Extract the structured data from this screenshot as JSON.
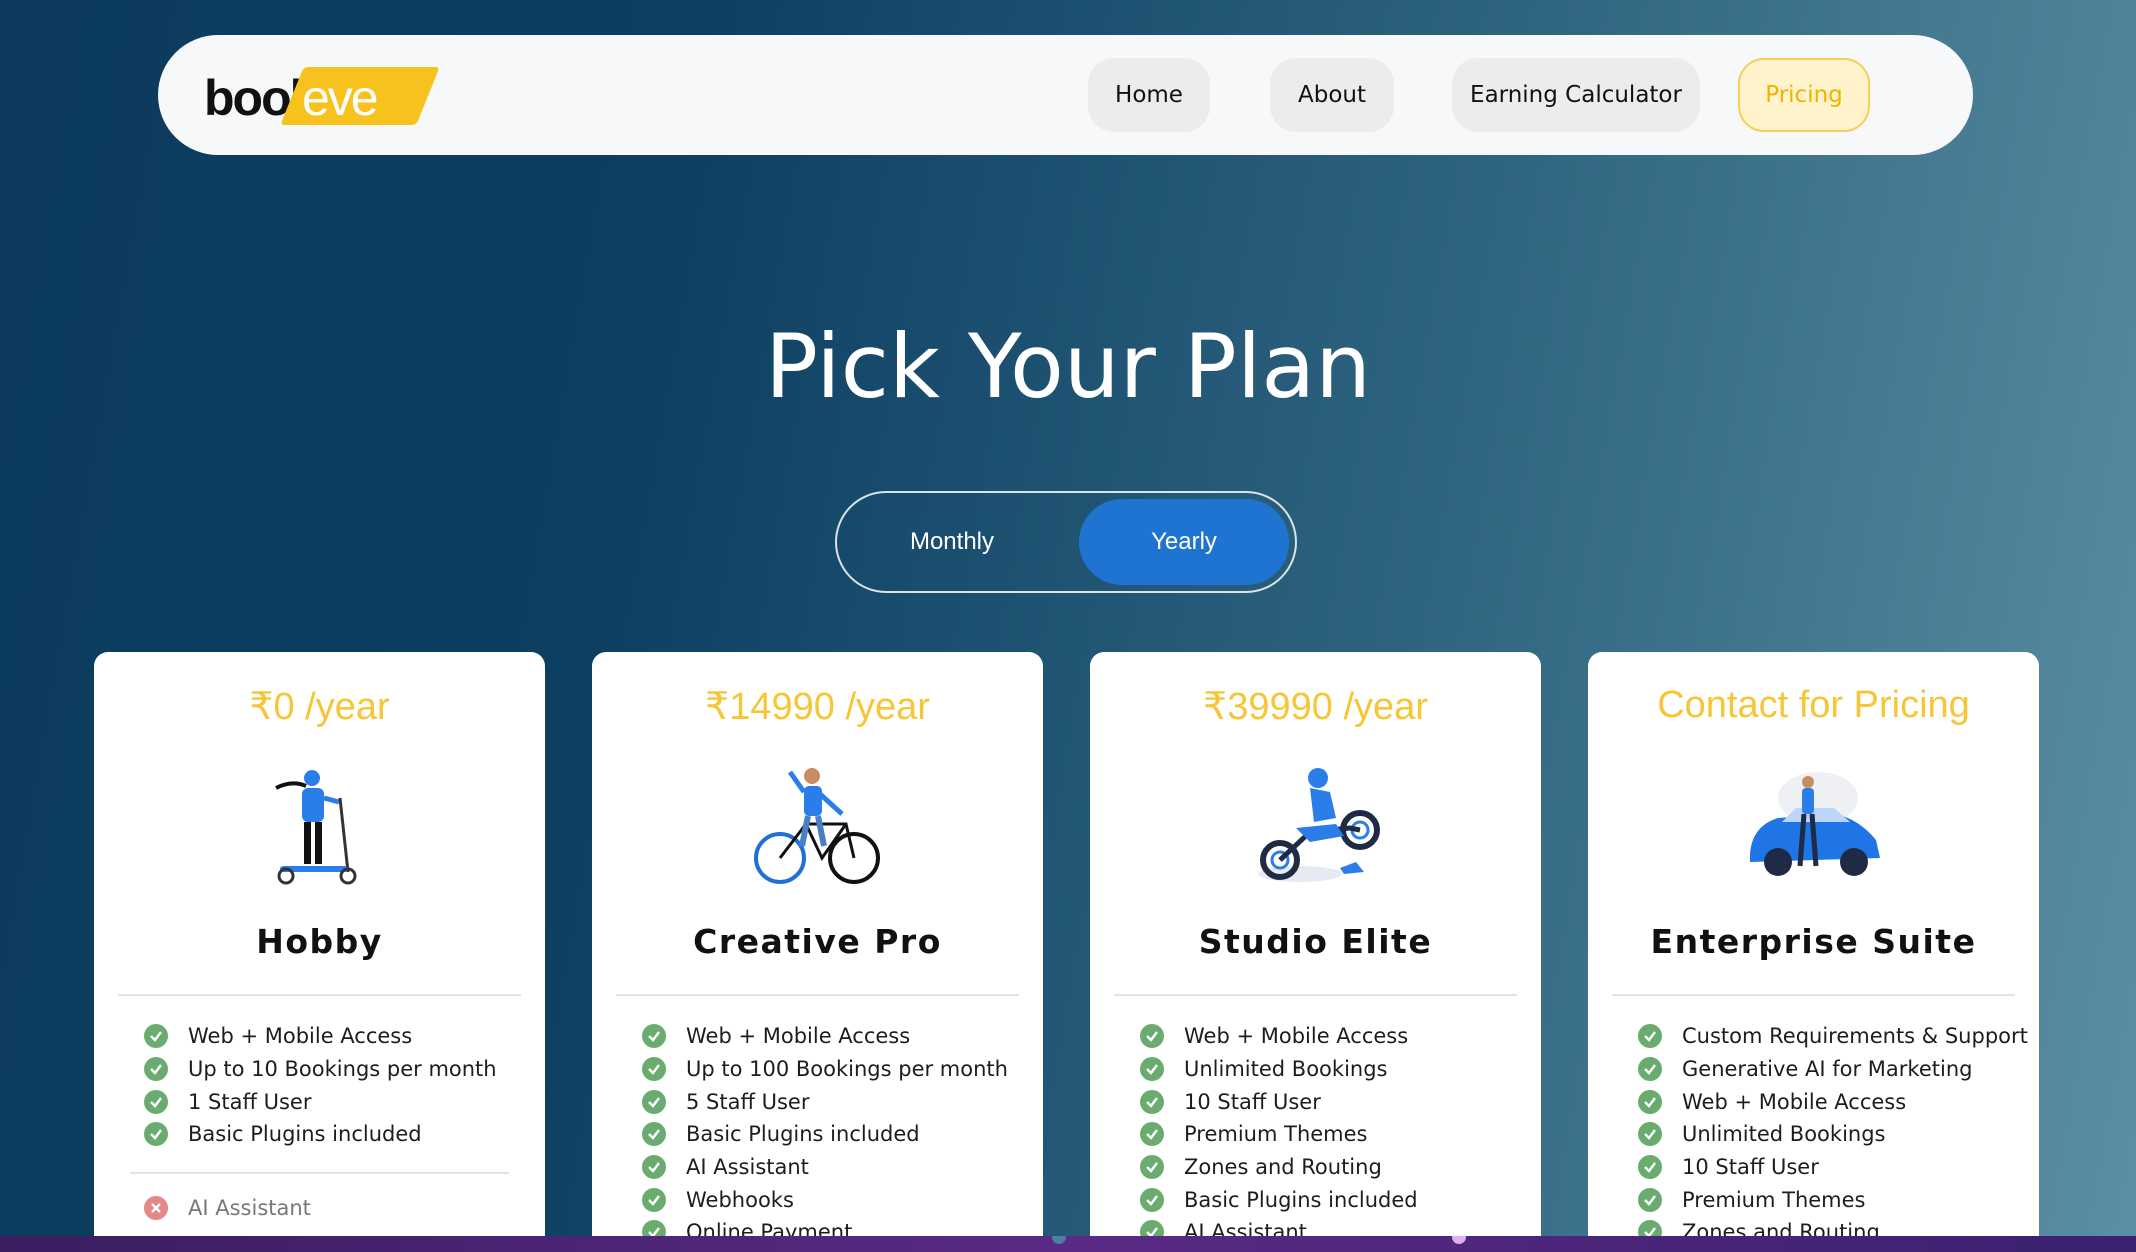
{
  "brand": {
    "logo_part1": "book",
    "logo_part2": "eve"
  },
  "nav": {
    "items": [
      {
        "label": "Home"
      },
      {
        "label": "About"
      },
      {
        "label": "Earning Calculator"
      },
      {
        "label": "Pricing",
        "active": true
      }
    ]
  },
  "hero": {
    "title": "Pick Your Plan"
  },
  "billing_toggle": {
    "monthly_label": "Monthly",
    "yearly_label": "Yearly",
    "selected": "Yearly"
  },
  "plans": [
    {
      "price": "₹0 /year",
      "name": "Hobby",
      "illustration": "scooter-rider-icon",
      "features": [
        "Web + Mobile Access",
        "Up to 10 Bookings per month",
        "1 Staff User",
        "Basic Plugins included"
      ],
      "excluded": [
        "AI Assistant"
      ]
    },
    {
      "price": "₹14990 /year",
      "name": "Creative Pro",
      "illustration": "bicycle-rider-icon",
      "features": [
        "Web + Mobile Access",
        "Up to 100 Bookings per month",
        "5 Staff User",
        "Basic Plugins included",
        "AI Assistant",
        "Webhooks",
        "Online Payment"
      ]
    },
    {
      "price": "₹39990 /year",
      "name": "Studio Elite",
      "illustration": "motorbike-rider-icon",
      "features": [
        "Web + Mobile Access",
        "Unlimited Bookings",
        "10 Staff User",
        "Premium Themes",
        "Zones and Routing",
        "Basic Plugins included",
        "AI Assistant"
      ]
    },
    {
      "price": "Contact for Pricing",
      "name": "Enterprise Suite",
      "illustration": "car-owner-icon",
      "features": [
        "Custom Requirements & Support",
        "Generative AI for Marketing",
        "Web + Mobile Access",
        "Unlimited Bookings",
        "10 Staff User",
        "Premium Themes",
        "Zones and Routing"
      ]
    }
  ],
  "colors": {
    "accent_yellow": "#f6c637",
    "toggle_blue": "#1f74d1",
    "check_green": "#6aac6f",
    "cross_red": "#e48787",
    "background_dark": "#0b3a5c",
    "background_light": "#5b8fa3"
  }
}
